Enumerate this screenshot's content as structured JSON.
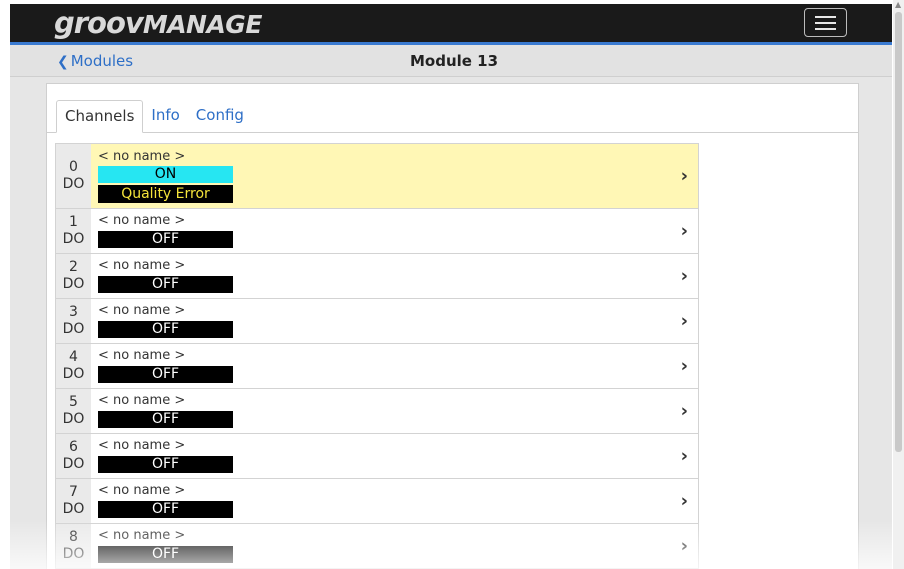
{
  "app": {
    "logo_groov": "groov",
    "logo_manage": "MANAGE",
    "menu_icon": "hamburger-icon"
  },
  "nav": {
    "back_label": "Modules",
    "back_icon": "chevron-left-icon",
    "title": "Module 13"
  },
  "tabs": [
    {
      "label": "Channels",
      "active": true
    },
    {
      "label": "Info",
      "active": false
    },
    {
      "label": "Config",
      "active": false
    }
  ],
  "channels": [
    {
      "index": "0",
      "type": "DO",
      "name": "< no name >",
      "state": "ON",
      "quality": "Quality Error"
    },
    {
      "index": "1",
      "type": "DO",
      "name": "< no name >",
      "state": "OFF"
    },
    {
      "index": "2",
      "type": "DO",
      "name": "< no name >",
      "state": "OFF"
    },
    {
      "index": "3",
      "type": "DO",
      "name": "< no name >",
      "state": "OFF"
    },
    {
      "index": "4",
      "type": "DO",
      "name": "< no name >",
      "state": "OFF"
    },
    {
      "index": "5",
      "type": "DO",
      "name": "< no name >",
      "state": "OFF"
    },
    {
      "index": "6",
      "type": "DO",
      "name": "< no name >",
      "state": "OFF"
    },
    {
      "index": "7",
      "type": "DO",
      "name": "< no name >",
      "state": "OFF"
    },
    {
      "index": "8",
      "type": "DO",
      "name": "< no name >",
      "state": "OFF"
    }
  ],
  "colors": {
    "accent": "#2e6fc7",
    "topbar": "#1a1a1a",
    "on_state": "#26e6f2",
    "error_row": "#fff7b5",
    "quality_text": "#f5e43a"
  }
}
